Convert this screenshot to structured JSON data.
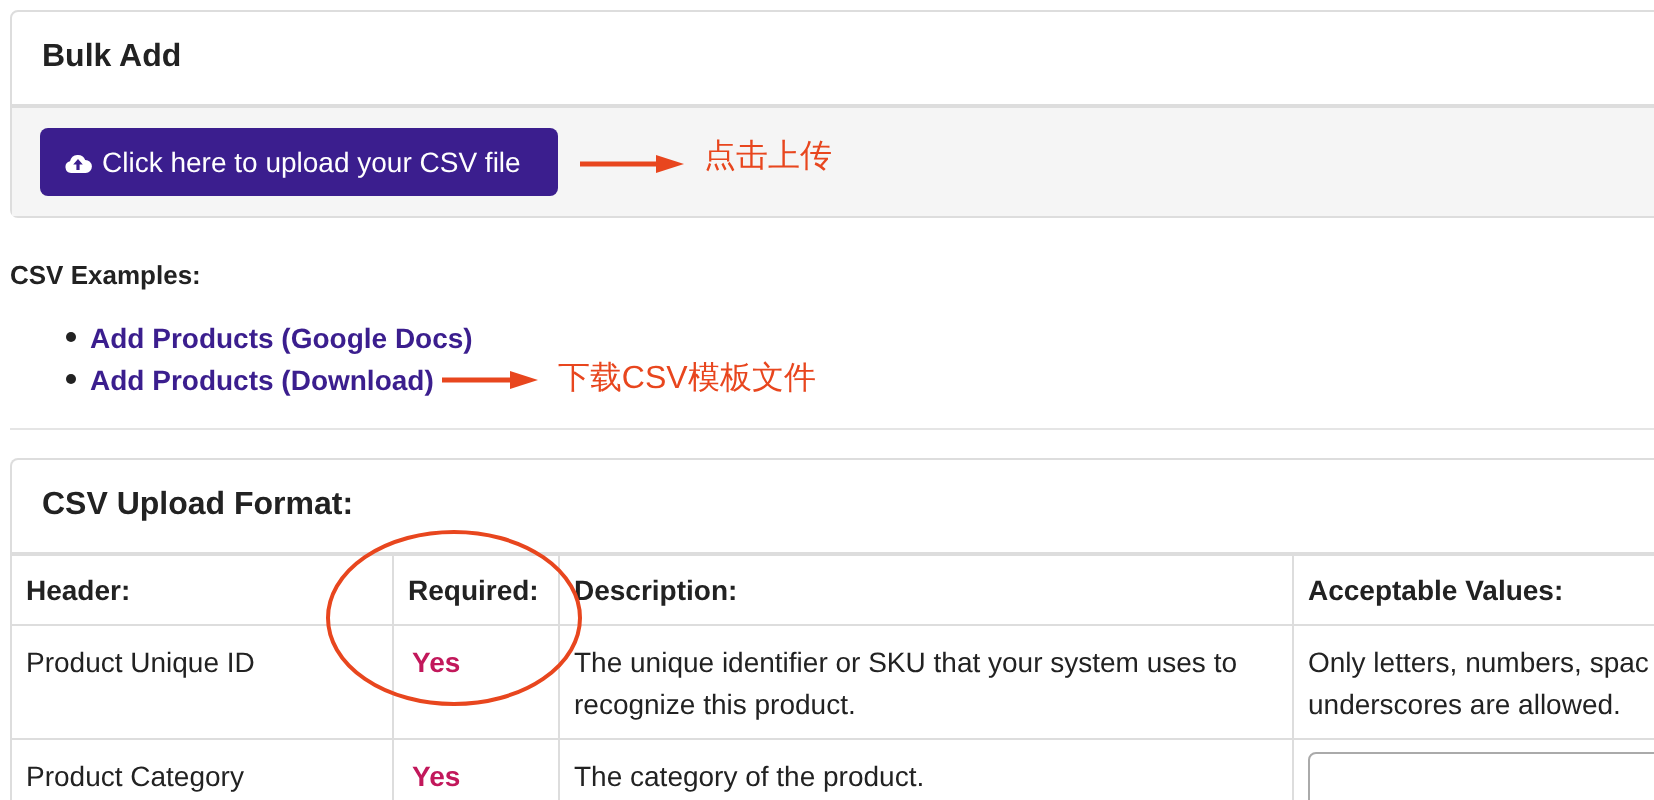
{
  "bulk_add": {
    "title": "Bulk Add",
    "upload_button": "Click here to upload your CSV file",
    "upload_note": "点击上传"
  },
  "examples": {
    "heading": "CSV Examples:",
    "links": [
      {
        "label": "Add Products (Google Docs)"
      },
      {
        "label": "Add Products (Download)",
        "note": "下载CSV模板文件"
      }
    ]
  },
  "format": {
    "title": "CSV Upload Format:",
    "columns": [
      "Header:",
      "Required:",
      "Description:",
      "Acceptable Values:"
    ],
    "rows": [
      {
        "header": "Product Unique ID",
        "required": "Yes",
        "description": "The unique identifier or SKU that your system uses to recognize this product.",
        "acceptable": {
          "kind": "text",
          "lines": [
            "Only letters, numbers, spac",
            "underscores are allowed."
          ]
        }
      },
      {
        "header": "Product Category",
        "required": "Yes",
        "description": "The category of the product.",
        "acceptable": {
          "kind": "select"
        }
      }
    ]
  }
}
